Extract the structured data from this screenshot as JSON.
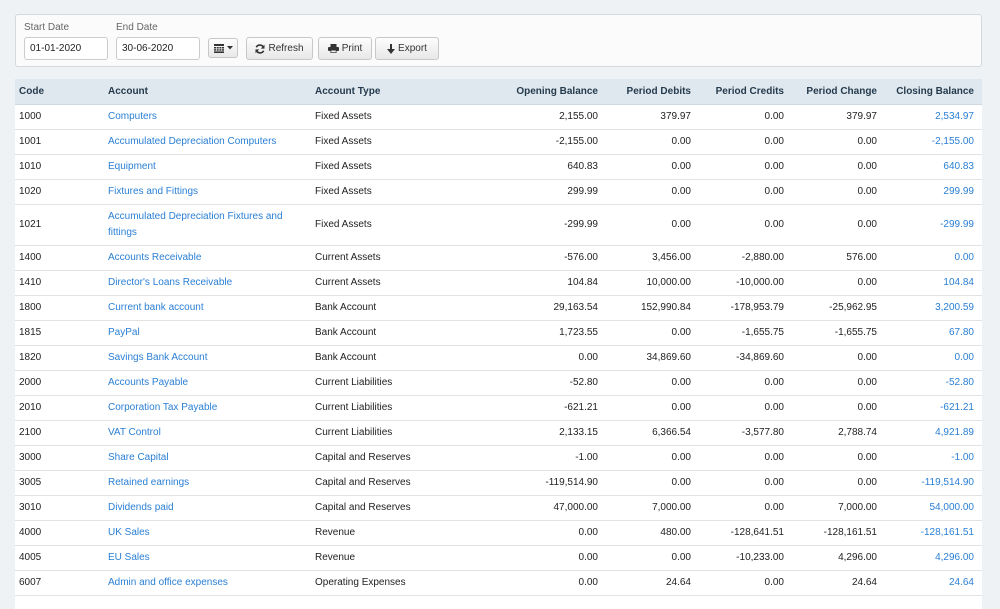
{
  "filters": {
    "start_date_label": "Start Date",
    "start_date_value": "01-01-2020",
    "end_date_label": "End Date",
    "end_date_value": "30-06-2020"
  },
  "toolbar": {
    "date_range_icon": "calendar-icon",
    "refresh_label": "Refresh",
    "refresh_icon": "refresh-icon",
    "print_label": "Print",
    "print_icon": "print-icon",
    "export_label": "Export",
    "export_icon": "download-icon"
  },
  "colors": {
    "link": "#2a7fd4",
    "header_bg": "#dfe8ee",
    "page_bg": "#eff2f5"
  },
  "table": {
    "columns": [
      "Code",
      "Account",
      "Account Type",
      "Opening Balance",
      "Period Debits",
      "Period Credits",
      "Period Change",
      "Closing Balance"
    ],
    "rows": [
      {
        "code": "1000",
        "account": "Computers",
        "type": "Fixed Assets",
        "opening": "2,155.00",
        "debits": "379.97",
        "credits": "0.00",
        "change": "379.97",
        "closing": "2,534.97"
      },
      {
        "code": "1001",
        "account": "Accumulated Depreciation Computers",
        "type": "Fixed Assets",
        "opening": "-2,155.00",
        "debits": "0.00",
        "credits": "0.00",
        "change": "0.00",
        "closing": "-2,155.00"
      },
      {
        "code": "1010",
        "account": "Equipment",
        "type": "Fixed Assets",
        "opening": "640.83",
        "debits": "0.00",
        "credits": "0.00",
        "change": "0.00",
        "closing": "640.83"
      },
      {
        "code": "1020",
        "account": "Fixtures and Fittings",
        "type": "Fixed Assets",
        "opening": "299.99",
        "debits": "0.00",
        "credits": "0.00",
        "change": "0.00",
        "closing": "299.99"
      },
      {
        "code": "1021",
        "account": "Accumulated Depreciation Fixtures and fittings",
        "type": "Fixed Assets",
        "opening": "-299.99",
        "debits": "0.00",
        "credits": "0.00",
        "change": "0.00",
        "closing": "-299.99"
      },
      {
        "code": "1400",
        "account": "Accounts Receivable",
        "type": "Current Assets",
        "opening": "-576.00",
        "debits": "3,456.00",
        "credits": "-2,880.00",
        "change": "576.00",
        "closing": "0.00"
      },
      {
        "code": "1410",
        "account": "Director's Loans Receivable",
        "type": "Current Assets",
        "opening": "104.84",
        "debits": "10,000.00",
        "credits": "-10,000.00",
        "change": "0.00",
        "closing": "104.84"
      },
      {
        "code": "1800",
        "account": "Current bank account",
        "type": "Bank Account",
        "opening": "29,163.54",
        "debits": "152,990.84",
        "credits": "-178,953.79",
        "change": "-25,962.95",
        "closing": "3,200.59"
      },
      {
        "code": "1815",
        "account": "PayPal",
        "type": "Bank Account",
        "opening": "1,723.55",
        "debits": "0.00",
        "credits": "-1,655.75",
        "change": "-1,655.75",
        "closing": "67.80"
      },
      {
        "code": "1820",
        "account": "Savings Bank Account",
        "type": "Bank Account",
        "opening": "0.00",
        "debits": "34,869.60",
        "credits": "-34,869.60",
        "change": "0.00",
        "closing": "0.00"
      },
      {
        "code": "2000",
        "account": "Accounts Payable",
        "type": "Current Liabilities",
        "opening": "-52.80",
        "debits": "0.00",
        "credits": "0.00",
        "change": "0.00",
        "closing": "-52.80"
      },
      {
        "code": "2010",
        "account": "Corporation Tax Payable",
        "type": "Current Liabilities",
        "opening": "-621.21",
        "debits": "0.00",
        "credits": "0.00",
        "change": "0.00",
        "closing": "-621.21"
      },
      {
        "code": "2100",
        "account": "VAT Control",
        "type": "Current Liabilities",
        "opening": "2,133.15",
        "debits": "6,366.54",
        "credits": "-3,577.80",
        "change": "2,788.74",
        "closing": "4,921.89"
      },
      {
        "code": "3000",
        "account": "Share Capital",
        "type": "Capital and Reserves",
        "opening": "-1.00",
        "debits": "0.00",
        "credits": "0.00",
        "change": "0.00",
        "closing": "-1.00"
      },
      {
        "code": "3005",
        "account": "Retained earnings",
        "type": "Capital and Reserves",
        "opening": "-119,514.90",
        "debits": "0.00",
        "credits": "0.00",
        "change": "0.00",
        "closing": "-119,514.90"
      },
      {
        "code": "3010",
        "account": "Dividends paid",
        "type": "Capital and Reserves",
        "opening": "47,000.00",
        "debits": "7,000.00",
        "credits": "0.00",
        "change": "7,000.00",
        "closing": "54,000.00"
      },
      {
        "code": "4000",
        "account": "UK Sales",
        "type": "Revenue",
        "opening": "0.00",
        "debits": "480.00",
        "credits": "-128,641.51",
        "change": "-128,161.51",
        "closing": "-128,161.51"
      },
      {
        "code": "4005",
        "account": "EU Sales",
        "type": "Revenue",
        "opening": "0.00",
        "debits": "0.00",
        "credits": "-10,233.00",
        "change": "4,296.00",
        "closing": "4,296.00"
      },
      {
        "code": "6007",
        "account": "Admin and office expenses",
        "type": "Operating Expenses",
        "opening": "0.00",
        "debits": "24.64",
        "credits": "0.00",
        "change": "24.64",
        "closing": "24.64"
      }
    ]
  }
}
